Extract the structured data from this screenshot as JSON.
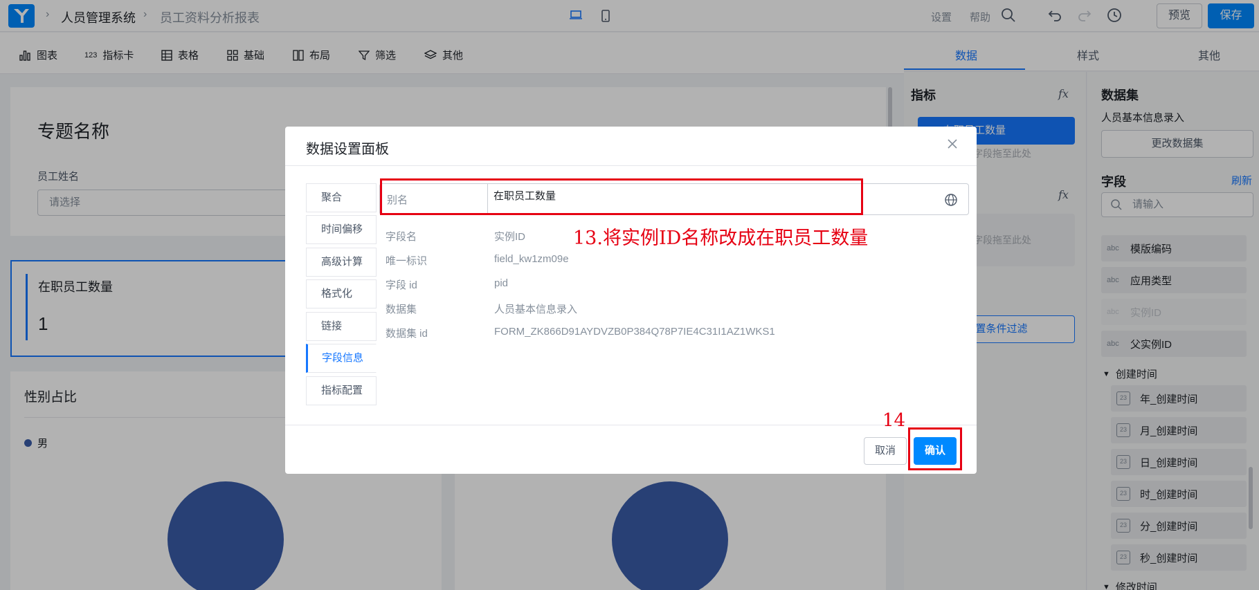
{
  "header": {
    "breadcrumb": [
      "人员管理系统",
      "员工资料分析报表"
    ],
    "settings": "设置",
    "help": "帮助",
    "preview": "预览",
    "save": "保存"
  },
  "toolbar": {
    "items": [
      "图表",
      "指标卡",
      "表格",
      "基础",
      "布局",
      "筛选",
      "其他"
    ]
  },
  "canvas": {
    "page_title": "专题名称",
    "filter_label": "员工姓名",
    "filter_placeholder": "请选择",
    "kpi_label": "在职员工数量",
    "kpi_value": "1",
    "chart_title": "性别占比",
    "legend_item": "男"
  },
  "right_tabs": [
    "数据",
    "样式",
    "其他"
  ],
  "metric_panel": {
    "title": "指标",
    "fx": "fx",
    "chip_label": "在职员工数量",
    "drop_hint": "字段拖至此处",
    "filter_button": "设置条件过滤"
  },
  "dataset_panel": {
    "title": "数据集",
    "dataset_name": "人员基本信息录入",
    "change_button": "更改数据集",
    "fields_title": "字段",
    "refresh": "刷新",
    "search_placeholder": "请输入",
    "fields": [
      {
        "type": "abc",
        "name": "模版编码"
      },
      {
        "type": "abc",
        "name": "应用类型"
      },
      {
        "type": "abc",
        "name": "实例ID"
      },
      {
        "type": "abc",
        "name": "父实例ID"
      }
    ],
    "group_created": "创建时间",
    "date_fields": [
      "年_创建时间",
      "月_创建时间",
      "日_创建时间",
      "时_创建时间",
      "分_创建时间",
      "秒_创建时间"
    ],
    "group_modified": "修改时间",
    "cal_glyph": "23"
  },
  "modal": {
    "title": "数据设置面板",
    "side_tabs": [
      "聚合",
      "时间偏移",
      "高级计算",
      "格式化",
      "链接",
      "字段信息",
      "指标配置"
    ],
    "alias_label": "别名",
    "alias_value": "在职员工数量",
    "info": [
      {
        "label": "字段名",
        "value": "实例ID"
      },
      {
        "label": "唯一标识",
        "value": "field_kw1zm09e"
      },
      {
        "label": "字段 id",
        "value": "pid"
      },
      {
        "label": "数据集",
        "value": "人员基本信息录入"
      },
      {
        "label": "数据集 id",
        "value": "FORM_ZK866D91AYDVZB0P384Q78P7IE4C31I1AZ1WKS1"
      }
    ],
    "cancel": "取消",
    "confirm": "确认"
  },
  "annotations": {
    "step13": "13.将实例ID名称改成在职员工数量",
    "step14": "14",
    "color": "#e60012"
  }
}
